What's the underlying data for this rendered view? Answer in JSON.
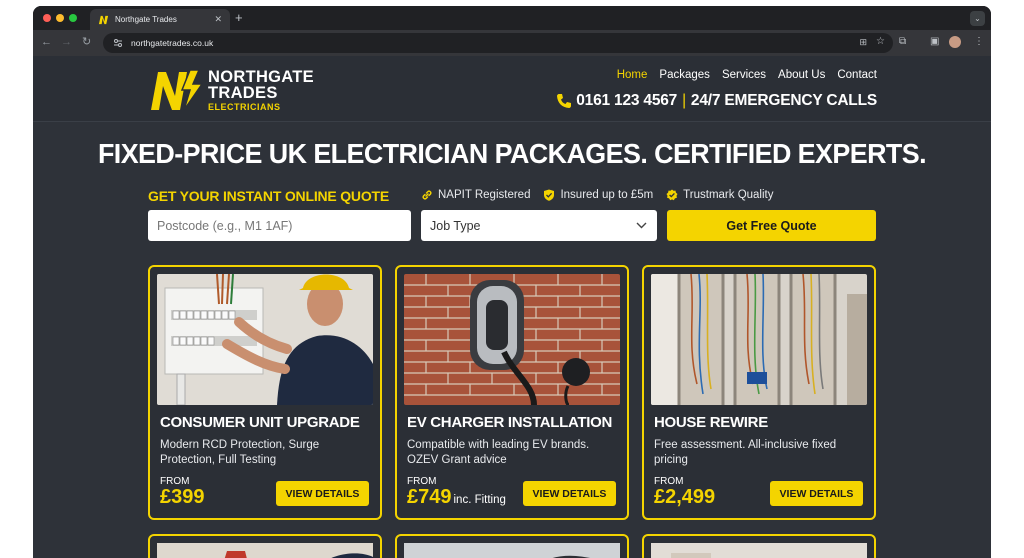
{
  "browser": {
    "tab_title": "Northgate Trades",
    "url": "northgatetrades.co.uk",
    "traffic_lights": [
      "#ff5f57",
      "#febc2e",
      "#28c840"
    ]
  },
  "site": {
    "logo": {
      "line1": "NORTHGATE",
      "line2": "TRADES",
      "line3": "ELECTRICIANS"
    },
    "nav": [
      {
        "label": "Home",
        "active": true
      },
      {
        "label": "Packages",
        "active": false
      },
      {
        "label": "Services",
        "active": false
      },
      {
        "label": "About Us",
        "active": false
      },
      {
        "label": "Contact",
        "active": false
      }
    ],
    "phone": {
      "number": "0161 123 4567",
      "separator": "|",
      "tagline": "24/7 EMERGENCY CALLS"
    },
    "hero_title": "FIXED-PRICE UK ELECTRICIAN PACKAGES. CERTIFIED EXPERTS.",
    "quote": {
      "label": "GET YOUR INSTANT ONLINE QUOTE",
      "postcode_placeholder": "Postcode (e.g., M1 1AF)",
      "job_type_value": "Job Type",
      "button_label": "Get Free Quote"
    },
    "badges": [
      {
        "label": "NAPIT Registered",
        "icon": "link-icon"
      },
      {
        "label": "Insured up to £5m",
        "icon": "shield-check-icon"
      },
      {
        "label": "Trustmark Quality",
        "icon": "badge-check-icon"
      }
    ],
    "packages": [
      {
        "title": "CONSUMER UNIT UPGRADE",
        "description": "Modern RCD Protection, Surge Protection, Full Testing",
        "from_label": "FROM",
        "price": "£399",
        "price_suffix": "",
        "button": "VIEW DETAILS"
      },
      {
        "title": "EV CHARGER INSTALLATION",
        "description": "Compatible with leading EV brands. OZEV Grant advice",
        "from_label": "FROM",
        "price": "£749",
        "price_suffix": "inc. Fitting",
        "button": "VIEW DETAILS"
      },
      {
        "title": "HOUSE REWIRE",
        "description": "Free assessment. All-inclusive fixed pricing",
        "from_label": "FROM",
        "price": "£2,499",
        "price_suffix": "",
        "button": "VIEW DETAILS"
      }
    ],
    "colors": {
      "accent": "#f4d400",
      "background": "#2e3239",
      "header": "#2b2f36"
    }
  }
}
